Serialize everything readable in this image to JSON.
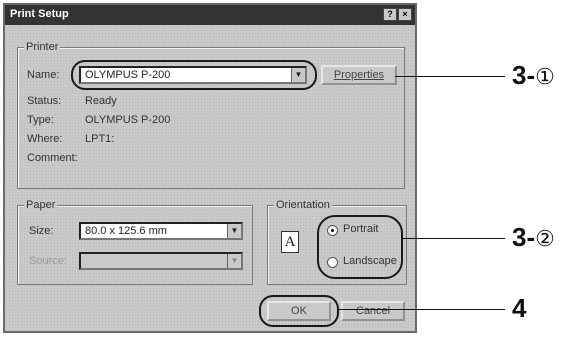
{
  "dialog": {
    "title": "Print Setup",
    "help_label": "?",
    "close_label": "×"
  },
  "printer": {
    "group_label": "Printer",
    "name_label": "Name:",
    "name_value": "OLYMPUS P-200",
    "properties_label": "Properties",
    "status_label": "Status:",
    "status_value": "Ready",
    "type_label": "Type:",
    "type_value": "OLYMPUS P-200",
    "where_label": "Where:",
    "where_value": "LPT1:",
    "comment_label": "Comment:",
    "comment_value": ""
  },
  "paper": {
    "group_label": "Paper",
    "size_label": "Size:",
    "size_value": "80.0 x 125.6 mm",
    "source_label": "Source:",
    "source_value": ""
  },
  "orientation": {
    "group_label": "Orientation",
    "icon_letter": "A",
    "portrait_label": "Portrait",
    "landscape_label": "Landscape",
    "selected": "Portrait"
  },
  "buttons": {
    "ok_label": "OK",
    "cancel_label": "Cancel"
  },
  "callouts": {
    "c1_text": "3-",
    "c1_circled": "①",
    "c2_text": "3-",
    "c2_circled": "②",
    "c3_text": "4"
  },
  "icons": {
    "combo_arrow": "chevron-down-icon",
    "radio": "radio-button-icon",
    "orientation": "portrait-page-icon"
  }
}
